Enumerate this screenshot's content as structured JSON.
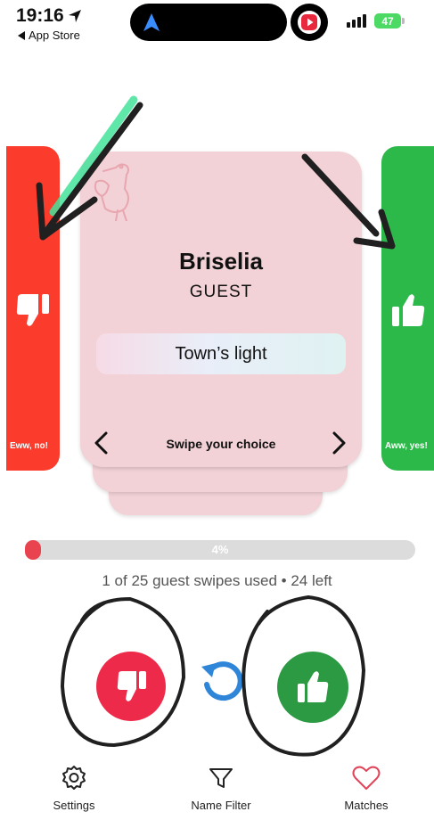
{
  "status_bar": {
    "time": "19:16",
    "back_label": "App Store",
    "battery": "47"
  },
  "left_panel": {
    "label": "Eww, no!",
    "color": "#fb3b2b"
  },
  "right_panel": {
    "label": "Aww, yes!",
    "color": "#2db84a"
  },
  "card": {
    "name": "Briselia",
    "type": "GUEST",
    "meaning": "Town’s light",
    "prompt": "Swipe your choice"
  },
  "progress": {
    "percent": 4,
    "label": "4%",
    "usage_text": "1 of 25 guest swipes used • 24 left"
  },
  "actions": {
    "dislike_color": "#ee2a4a",
    "like_color": "#2c9a42",
    "undo_color": "#2f86d8"
  },
  "tabs": [
    {
      "label": "Settings",
      "icon": "gear-icon"
    },
    {
      "label": "Name Filter",
      "icon": "filter-icon"
    },
    {
      "label": "Matches",
      "icon": "heart-icon"
    }
  ],
  "icons": {
    "dislike": "thumbs-down-icon",
    "like": "thumbs-up-icon",
    "undo": "undo-icon",
    "decoration": "stork-icon"
  }
}
